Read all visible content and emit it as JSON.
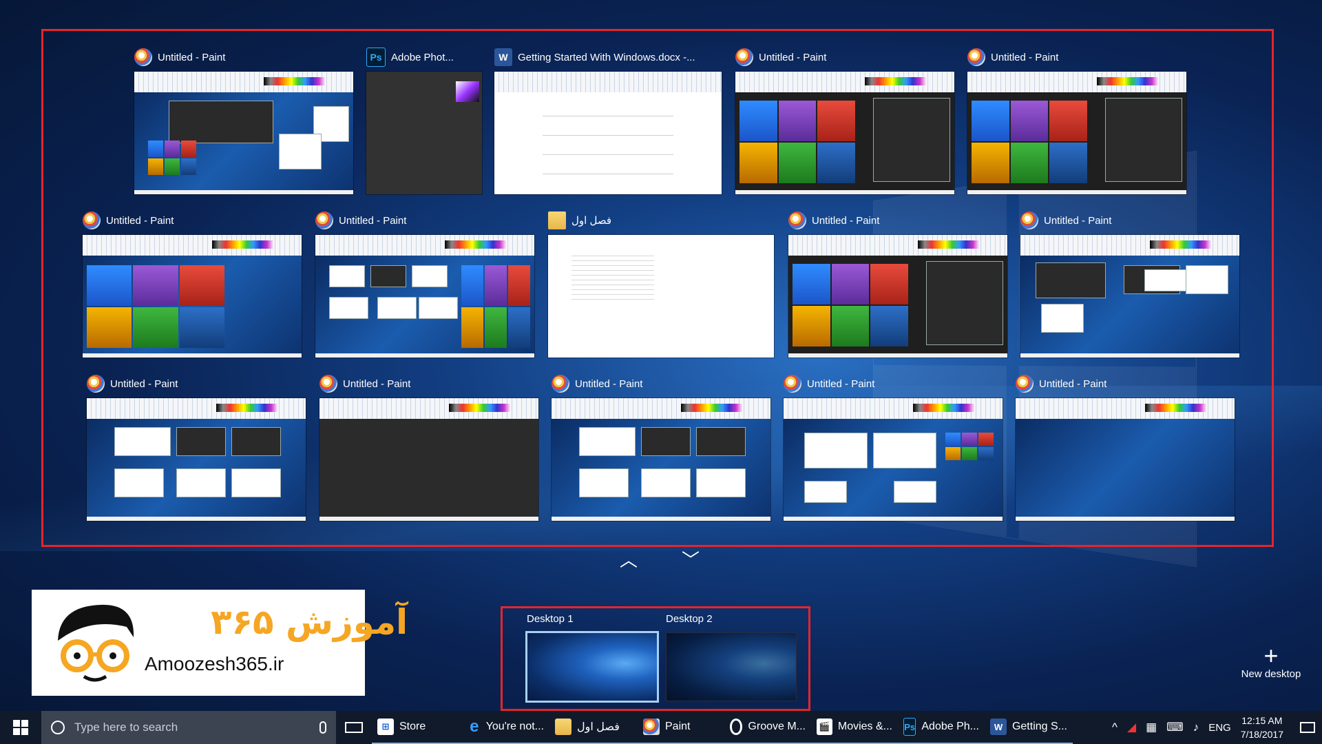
{
  "windows": [
    {
      "title": "Untitled - Paint",
      "icon": "paint-icon"
    },
    {
      "title": "Adobe Phot...",
      "icon": "photoshop-icon",
      "icon_text": "Ps"
    },
    {
      "title": "Getting Started With Windows.docx -...",
      "icon": "word-icon",
      "icon_text": "W"
    },
    {
      "title": "Untitled - Paint",
      "icon": "paint-icon"
    },
    {
      "title": "Untitled - Paint",
      "icon": "paint-icon"
    },
    {
      "title": "Untitled - Paint",
      "icon": "paint-icon"
    },
    {
      "title": "Untitled - Paint",
      "icon": "paint-icon"
    },
    {
      "title": "فصل اول",
      "icon": "folder-icon"
    },
    {
      "title": "Untitled - Paint",
      "icon": "paint-icon"
    },
    {
      "title": "Untitled - Paint",
      "icon": "paint-icon"
    },
    {
      "title": "Untitled - Paint",
      "icon": "paint-icon"
    },
    {
      "title": "Untitled - Paint",
      "icon": "paint-icon"
    },
    {
      "title": "Untitled - Paint",
      "icon": "paint-icon"
    },
    {
      "title": "Untitled - Paint",
      "icon": "paint-icon"
    },
    {
      "title": "Untitled - Paint",
      "icon": "paint-icon"
    }
  ],
  "scroll": {
    "up": "︿",
    "down": "﹀"
  },
  "desktops": [
    {
      "label": "Desktop 1",
      "active": true
    },
    {
      "label": "Desktop 2",
      "active": false
    }
  ],
  "new_desktop": {
    "plus": "+",
    "label": "New desktop"
  },
  "brand": {
    "persian": "آموزش ۳۶۵",
    "latin": "Amoozesh365.ir"
  },
  "taskbar": {
    "search_placeholder": "Type here to search",
    "apps": [
      {
        "label": "Store",
        "icon": "store-icon",
        "icon_text": "⊞"
      },
      {
        "label": "You're not...",
        "icon": "edge-icon",
        "icon_text": "e"
      },
      {
        "label": "فصل اول",
        "icon": "folder-icon",
        "icon_text": ""
      },
      {
        "label": "Paint",
        "icon": "paint-icon",
        "icon_text": ""
      },
      {
        "label": "Groove M...",
        "icon": "groove-music-icon",
        "icon_text": ""
      },
      {
        "label": "Movies &...",
        "icon": "movies-icon",
        "icon_text": "🎬"
      },
      {
        "label": "Adobe Ph...",
        "icon": "photoshop-icon",
        "icon_text": "Ps"
      },
      {
        "label": "Getting S...",
        "icon": "word-icon",
        "icon_text": "W"
      }
    ],
    "tray": {
      "chevron": "^",
      "language": "ENG",
      "time": "12:15 AM",
      "date": "7/18/2017"
    }
  },
  "colors": {
    "highlight_frame": "#e8242a",
    "active_desktop_border": "#a8d0f6",
    "brand_orange": "#f5a623"
  }
}
